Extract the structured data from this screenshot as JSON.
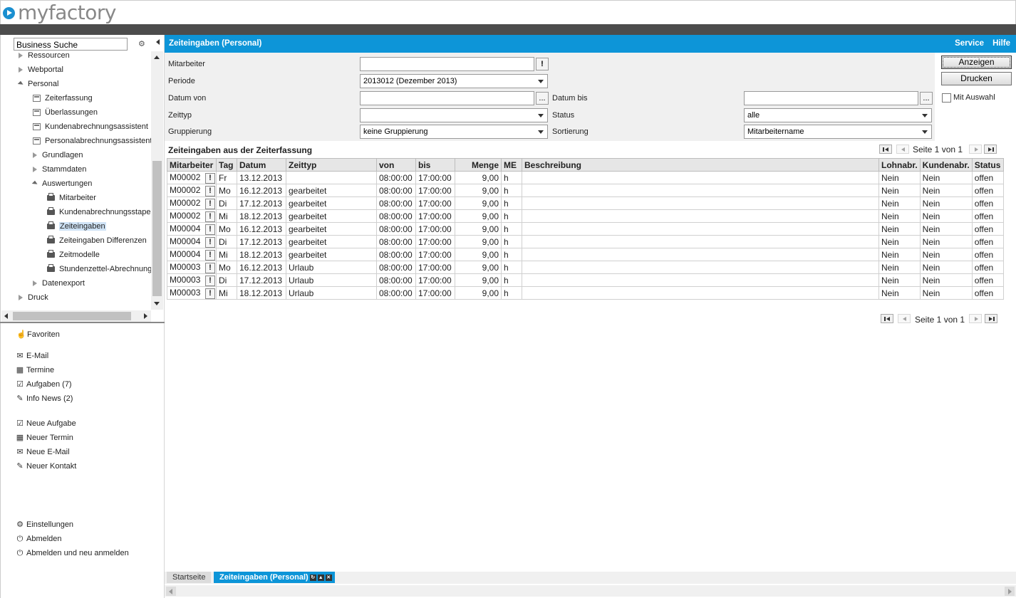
{
  "app": {
    "logo_text": "myfactory",
    "brand_color": "#0d95d8"
  },
  "sidebar": {
    "search_value": "Business Suche",
    "tree": [
      {
        "label": "Ressourcen",
        "level": 1,
        "type": "collapsed"
      },
      {
        "label": "Webportal",
        "level": 1,
        "type": "collapsed"
      },
      {
        "label": "Personal",
        "level": 1,
        "type": "expanded"
      },
      {
        "label": "Zeiterfassung",
        "level": 2,
        "type": "form-icon"
      },
      {
        "label": "Überlassungen",
        "level": 2,
        "type": "form-icon"
      },
      {
        "label": "Kundenabrechnungsassistent",
        "level": 2,
        "type": "form-icon"
      },
      {
        "label": "Personalabrechnungsassistent",
        "level": 2,
        "type": "form-icon"
      },
      {
        "label": "Grundlagen",
        "level": 2,
        "type": "collapsed"
      },
      {
        "label": "Stammdaten",
        "level": 2,
        "type": "collapsed"
      },
      {
        "label": "Auswertungen",
        "level": 2,
        "type": "expanded"
      },
      {
        "label": "Mitarbeiter",
        "level": 3,
        "type": "print-icon"
      },
      {
        "label": "Kundenabrechnungsstapel",
        "level": 3,
        "type": "print-icon"
      },
      {
        "label": "Zeiteingaben",
        "level": 3,
        "type": "print-icon",
        "selected": true
      },
      {
        "label": "Zeiteingaben Differenzen",
        "level": 3,
        "type": "print-icon"
      },
      {
        "label": "Zeitmodelle",
        "level": 3,
        "type": "print-icon"
      },
      {
        "label": "Stundenzettel-Abrechnung",
        "level": 3,
        "type": "print-icon"
      },
      {
        "label": "Datenexport",
        "level": 2,
        "type": "collapsed"
      },
      {
        "label": "Druck",
        "level": 1,
        "type": "collapsed"
      }
    ],
    "favorites_label": "Favoriten",
    "links1": [
      {
        "label": "E-Mail",
        "icon": "envelope-icon"
      },
      {
        "label": "Termine",
        "icon": "calendar-icon"
      },
      {
        "label": "Aufgaben (7)",
        "icon": "tasks-icon"
      },
      {
        "label": "Info News (2)",
        "icon": "pin-icon"
      }
    ],
    "links2": [
      {
        "label": "Neue Aufgabe",
        "icon": "tasks-icon"
      },
      {
        "label": "Neuer Termin",
        "icon": "calendar-icon"
      },
      {
        "label": "Neue E-Mail",
        "icon": "envelope-icon"
      },
      {
        "label": "Neuer Kontakt",
        "icon": "pin-icon"
      }
    ],
    "links3": [
      {
        "label": "Einstellungen",
        "icon": "gear-icon"
      },
      {
        "label": "Abmelden",
        "icon": "power-icon"
      },
      {
        "label": "Abmelden und neu anmelden",
        "icon": "power-icon"
      }
    ]
  },
  "header": {
    "title": "Zeiteingaben (Personal)",
    "service": "Service",
    "help": "Hilfe"
  },
  "form": {
    "mitarbeiter_label": "Mitarbeiter",
    "mitarbeiter_value": "",
    "periode_label": "Periode",
    "periode_value": "2013012 (Dezember 2013)",
    "datum_von_label": "Datum von",
    "datum_von_value": "",
    "datum_bis_label": "Datum bis",
    "datum_bis_value": "",
    "zeittyp_label": "Zeittyp",
    "zeittyp_value": "",
    "status_label": "Status",
    "status_value": "alle",
    "gruppierung_label": "Gruppierung",
    "gruppierung_value": "keine Gruppierung",
    "sortierung_label": "Sortierung",
    "sortierung_value": "Mitarbeitername",
    "excl_btn": "!",
    "dots_btn": "...",
    "anzeigen": "Anzeigen",
    "drucken": "Drucken",
    "mit_auswahl": "Mit Auswahl"
  },
  "grid": {
    "title": "Zeiteingaben aus der Zeiterfassung",
    "pager_text": "Seite 1 von 1",
    "columns": [
      "Mitarbeiter",
      "Tag",
      "Datum",
      "Zeittyp",
      "von",
      "bis",
      "Menge",
      "ME",
      "Beschreibung",
      "Lohnabr.",
      "Kundenabr.",
      "Status"
    ],
    "rows": [
      [
        "M00002",
        "Fr",
        "13.12.2013",
        "",
        "08:00:00",
        "17:00:00",
        "9,00",
        "h",
        "",
        "Nein",
        "Nein",
        "offen"
      ],
      [
        "M00002",
        "Mo",
        "16.12.2013",
        "gearbeitet",
        "08:00:00",
        "17:00:00",
        "9,00",
        "h",
        "",
        "Nein",
        "Nein",
        "offen"
      ],
      [
        "M00002",
        "Di",
        "17.12.2013",
        "gearbeitet",
        "08:00:00",
        "17:00:00",
        "9,00",
        "h",
        "",
        "Nein",
        "Nein",
        "offen"
      ],
      [
        "M00002",
        "Mi",
        "18.12.2013",
        "gearbeitet",
        "08:00:00",
        "17:00:00",
        "9,00",
        "h",
        "",
        "Nein",
        "Nein",
        "offen"
      ],
      [
        "M00004",
        "Mo",
        "16.12.2013",
        "gearbeitet",
        "08:00:00",
        "17:00:00",
        "9,00",
        "h",
        "",
        "Nein",
        "Nein",
        "offen"
      ],
      [
        "M00004",
        "Di",
        "17.12.2013",
        "gearbeitet",
        "08:00:00",
        "17:00:00",
        "9,00",
        "h",
        "",
        "Nein",
        "Nein",
        "offen"
      ],
      [
        "M00004",
        "Mi",
        "18.12.2013",
        "gearbeitet",
        "08:00:00",
        "17:00:00",
        "9,00",
        "h",
        "",
        "Nein",
        "Nein",
        "offen"
      ],
      [
        "M00003",
        "Mo",
        "16.12.2013",
        "Urlaub",
        "08:00:00",
        "17:00:00",
        "9,00",
        "h",
        "",
        "Nein",
        "Nein",
        "offen"
      ],
      [
        "M00003",
        "Di",
        "17.12.2013",
        "Urlaub",
        "08:00:00",
        "17:00:00",
        "9,00",
        "h",
        "",
        "Nein",
        "Nein",
        "offen"
      ],
      [
        "M00003",
        "Mi",
        "18.12.2013",
        "Urlaub",
        "08:00:00",
        "17:00:00",
        "9,00",
        "h",
        "",
        "Nein",
        "Nein",
        "offen"
      ]
    ]
  },
  "tabs": [
    {
      "label": "Startseite",
      "active": false
    },
    {
      "label": "Zeiteingaben (Personal)",
      "active": true
    }
  ]
}
